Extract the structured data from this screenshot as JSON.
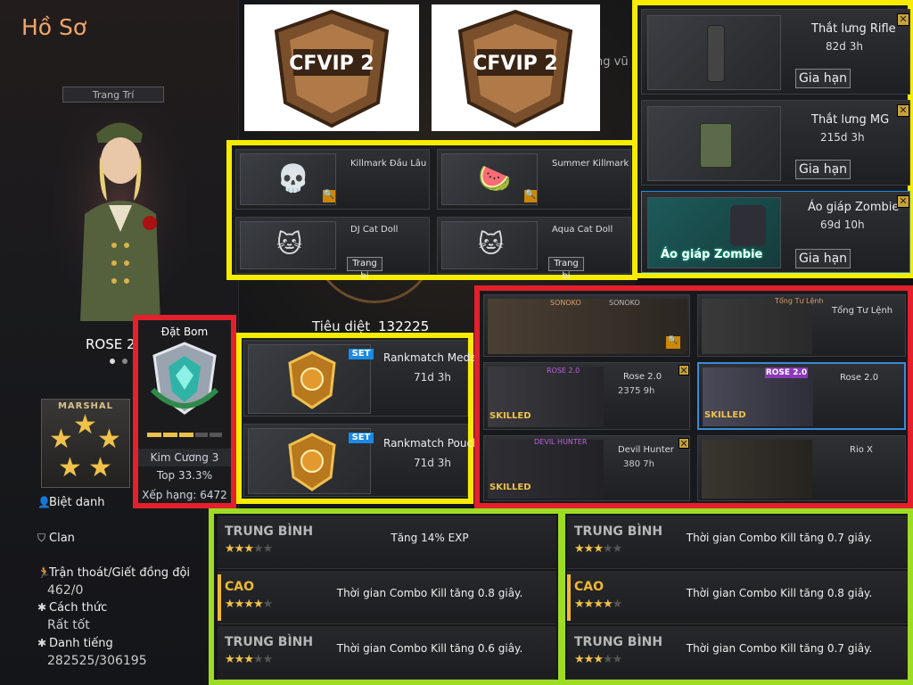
{
  "profile": {
    "title": "Hồ Sơ",
    "decorate_button": "Trang Trí",
    "player_name": "ROSE 2",
    "rank_badge_label": "MARSHAL",
    "stats": {
      "nickname_label": "Biệt danh",
      "clan_label": "Clan",
      "escape_label": "Trận thoát/Giết đồng đội",
      "escape_value": "462/0",
      "behavior_label": "Cách thức",
      "behavior_value": "Rất tốt",
      "reputation_label": "Danh tiếng",
      "reputation_value": "282525/306195"
    }
  },
  "ranked": {
    "mode": "Đặt Bom",
    "tier": "Kim Cương 3",
    "top": "Top 33.3%",
    "rank": "Xếp hạng: 6472"
  },
  "kills": {
    "label": "Tiêu diệt",
    "value": "132225"
  },
  "top_images": [
    "CFVIP 2",
    "CFVIP 2"
  ],
  "partial_tab_text": "ng vũ",
  "killmarks": [
    {
      "name": "Killmark Đầu Lâu",
      "button": null
    },
    {
      "name": "Summer Killmark",
      "button": null
    },
    {
      "name": "DJ Cat Doll",
      "button": "Trang bị"
    },
    {
      "name": "Aqua Cat Doll",
      "button": "Trang bị"
    }
  ],
  "belts": [
    {
      "name": "Thắt lưng Rifle",
      "duration": "82d 3h",
      "button": "Gia hạn"
    },
    {
      "name": "Thắt lưng MG",
      "duration": "215d 3h",
      "button": "Gia hạn"
    },
    {
      "name": "Áo giáp Zombie",
      "duration": "69d 10h",
      "button": "Gia hạn",
      "art_label": "Áo giáp Zombie"
    }
  ],
  "rank_medals": [
    {
      "name": "Rankmatch Meda",
      "duration": "71d 3h",
      "badge": "SET"
    },
    {
      "name": "Rankmatch Pouch",
      "duration": "71d 3h",
      "badge": "SET"
    }
  ],
  "characters": [
    {
      "name": "SONOKO",
      "tag": "SONOKO",
      "sub": "",
      "skilled": ""
    },
    {
      "name": "Tổng Tư Lệnh",
      "tag": "Tổng Tư Lệnh",
      "sub": "",
      "skilled": ""
    },
    {
      "name": "Rose 2.0",
      "tag": "ROSE 2.0",
      "sub": "2375 9h",
      "skilled": "SKILLED"
    },
    {
      "name": "Rose 2.0",
      "tag": "ROSE 2.0",
      "sub": "",
      "skilled": "SKILLED"
    },
    {
      "name": "Devil Hunter",
      "tag": "DEVIL HUNTER",
      "sub": "380 7h",
      "skilled": "SKILLED"
    },
    {
      "name": "Rio X",
      "tag": "",
      "sub": "",
      "skilled": ""
    }
  ],
  "perks_left": [
    {
      "tier": "TRUNG BÌNH",
      "stars": 3,
      "desc": "Tăng 14% EXP"
    },
    {
      "tier": "CAO",
      "stars": 4,
      "desc": "Thời gian Combo Kill tăng 0.8 giây."
    },
    {
      "tier": "TRUNG BÌNH",
      "stars": 3,
      "desc": "Thời gian Combo Kill tăng 0.6 giây."
    }
  ],
  "perks_right": [
    {
      "tier": "TRUNG BÌNH",
      "stars": 3,
      "desc": "Thời gian Combo Kill tăng 0.7 giây."
    },
    {
      "tier": "CAO",
      "stars": 4,
      "desc": "Thời gian Combo Kill tăng 0.8 giây."
    },
    {
      "tier": "TRUNG BÌNH",
      "stars": 3,
      "desc": "Thời gian Combo Kill tăng 0.7 giây."
    }
  ],
  "colors": {
    "highlight_yellow": "#f7ec00",
    "highlight_red": "#e4202c",
    "highlight_green": "#9edc24",
    "title_orange": "#f2a66a",
    "tier_mid": "#b8b8b8",
    "tier_high": "#f0b830",
    "star_gold": "#f1c24a"
  }
}
